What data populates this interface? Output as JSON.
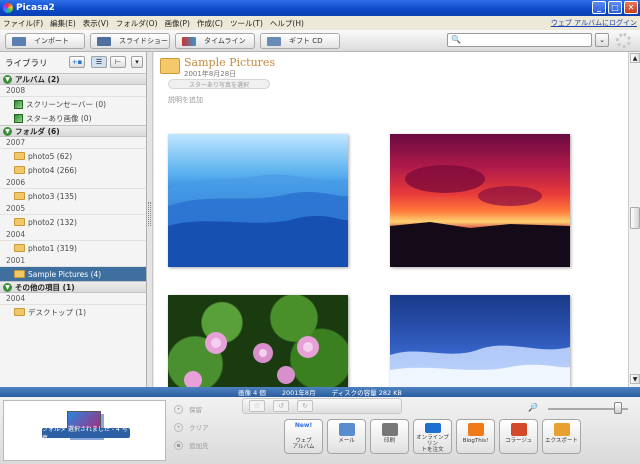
{
  "window": {
    "title": "Picasa2"
  },
  "menu": {
    "items": [
      "ファイル(F)",
      "編集(E)",
      "表示(V)",
      "フォルダ(O)",
      "画像(P)",
      "作成(C)",
      "ツール(T)",
      "ヘルプ(H)"
    ],
    "web_album_link": "ウェブ アルバムにログイン"
  },
  "toolbar": {
    "import": "インポート",
    "slideshow": "スライドショー",
    "timeline": "タイムライン",
    "giftcd": "ギフト CD"
  },
  "search": {
    "placeholder": ""
  },
  "library": {
    "title": "ライブラリ",
    "groups": [
      {
        "label": "アルバム (2)",
        "sections": [
          {
            "year": "2008",
            "items": [
              {
                "label": "スクリーンセーバー (0)",
                "kind": "album"
              },
              {
                "label": "スターあり画像 (0)",
                "kind": "album"
              }
            ]
          }
        ]
      },
      {
        "label": "フォルダ (6)",
        "sections": [
          {
            "year": "2007",
            "items": [
              {
                "label": "photo5 (62)",
                "kind": "folder"
              },
              {
                "label": "photo4 (266)",
                "kind": "folder"
              }
            ]
          },
          {
            "year": "2006",
            "items": [
              {
                "label": "photo3 (135)",
                "kind": "folder"
              }
            ]
          },
          {
            "year": "2005",
            "items": [
              {
                "label": "photo2 (132)",
                "kind": "folder"
              }
            ]
          },
          {
            "year": "2004",
            "items": [
              {
                "label": "photo1 (319)",
                "kind": "folder"
              }
            ]
          },
          {
            "year": "2001",
            "items": [
              {
                "label": "Sample Pictures (4)",
                "kind": "folder",
                "selected": true
              }
            ]
          }
        ]
      },
      {
        "label": "その他の項目 (1)",
        "sections": [
          {
            "year": "2004",
            "items": [
              {
                "label": "デスクトップ (1)",
                "kind": "folder"
              }
            ]
          }
        ]
      }
    ]
  },
  "folder_view": {
    "title": "Sample Pictures",
    "date": "2001年8月28日",
    "star_button": "スターあり写真を選択",
    "caption_placeholder": "説明を追加"
  },
  "status": {
    "count": "画像 4 個",
    "date": "2001年8月",
    "disk": "ディスクの容量 282 KB"
  },
  "tray": {
    "label": "フォルダ 選択されました - 4 写真",
    "hold": "保留",
    "clear": "クリア",
    "add": "追加先"
  },
  "actions": [
    {
      "label": "ウェブ\nアルバム",
      "badge": "New!",
      "icon": "web-album-icon",
      "color": "#2f6fe0"
    },
    {
      "label": "メール",
      "icon": "email-icon",
      "color": "#5a8cd0"
    },
    {
      "label": "印刷",
      "icon": "print-icon",
      "color": "#777777"
    },
    {
      "label": "オンラインプリン\nトを注文",
      "icon": "globe-icon",
      "color": "#1e6fd0"
    },
    {
      "label": "BlogThis!",
      "icon": "blogger-icon",
      "color": "#f07a1a"
    },
    {
      "label": "コラージュ",
      "icon": "collage-icon",
      "color": "#d24a2a"
    },
    {
      "label": "エクスポート",
      "icon": "export-icon",
      "color": "#e8a030"
    }
  ],
  "colors": {
    "titlebar": "#0b49c7",
    "selection": "#3f6f9f",
    "status": "#2a5d9e",
    "folder_title": "#c4893d"
  }
}
